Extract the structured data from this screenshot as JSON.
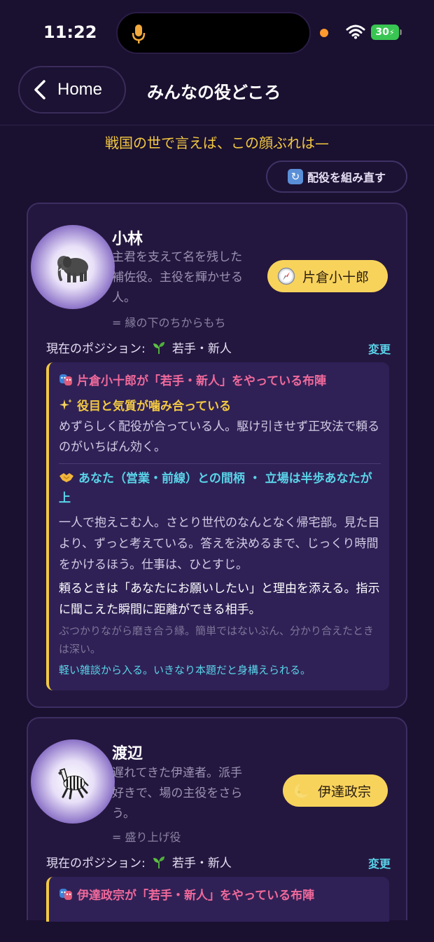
{
  "status_bar": {
    "time": "11:22",
    "battery": "30"
  },
  "header": {
    "back_label": "Home",
    "title": "みんなの役どころ"
  },
  "subtitle": "戦国の世で言えば、この顔ぶれは—",
  "reshuffle_label": "配役を組み直す",
  "position_prefix": "現在のポジション:",
  "change_label": "変更",
  "cards": [
    {
      "name": "小林",
      "animal_icon": "elephant-icon",
      "description": "主君を支えて名を残した補佐役。主役を輝かせる人。",
      "nickname": "= 縁の下のちからもち",
      "role_icon": "compass-icon",
      "role": "片倉小十郎",
      "position": "若手・新人",
      "detail_heading": "片倉小十郎が「若手・新人」をやっている布陣",
      "match_heading": "役目と気質が噛み合っている",
      "match_body": "めずらしく配役が合っている人。駆け引きせず正攻法で頼るのがいちばん効く。",
      "relation_heading": "あなた（営業・前線）との間柄 ・ 立場は半歩あなたが上",
      "relation_body1": "一人で抱えこむ人。さとり世代のなんとなく帰宅部。見た目より、ずっと考えている。答えを決めるまで、じっくり時間をかけるほう。仕事は、ひとすじ。",
      "relation_body2": "頼るときは「あなたにお願いしたい」と理由を添える。指示に聞こえた瞬間に距離ができる相手。",
      "relation_note": "ぶつかりながら磨き合う縁。簡単ではないぶん、分かり合えたときは深い。",
      "relation_tip": "軽い雑談から入る。いきなり本題だと身構えられる。"
    },
    {
      "name": "渡辺",
      "animal_icon": "zebra-icon",
      "description": "遅れてきた伊達者。派手好きで、場の主役をさらう。",
      "nickname": "= 盛り上げ役",
      "role_icon": "moon-icon",
      "role": "伊達政宗",
      "position": "若手・新人",
      "detail_heading": "伊達政宗が「若手・新人」をやっている布陣"
    }
  ],
  "colors": {
    "background": "#1a1030",
    "card": "#24173f",
    "accent_yellow": "#f8d35c",
    "accent_pink": "#f0699b",
    "accent_cyan": "#5ad3e8"
  }
}
